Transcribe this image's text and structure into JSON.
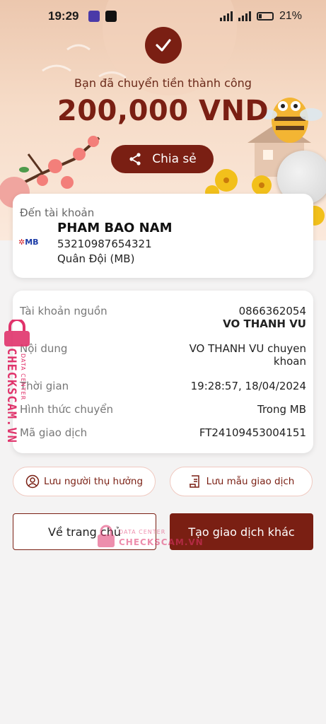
{
  "status_bar": {
    "time": "19:29",
    "battery": "21%"
  },
  "hero": {
    "success_text": "Bạn đã chuyển tiền thành công",
    "amount": "200,000 VND",
    "share_label": "Chia sẻ"
  },
  "destination": {
    "label": "Đến tài khoản",
    "bank_logo": "MB",
    "name": "PHAM BAO NAM",
    "account_number": "53210987654321",
    "bank": "Quân Đội (MB)"
  },
  "details": {
    "rows": [
      {
        "label": "Tài khoản nguồn",
        "value": "0866362054",
        "value2": "VO THANH VU"
      },
      {
        "label": "Nội dung",
        "value": "VO THANH VU chuyen",
        "value2": "khoan"
      },
      {
        "label": "Thời gian",
        "value": "19:28:57, 18/04/2024"
      },
      {
        "label": "Hình thức chuyển",
        "value": "Trong MB"
      },
      {
        "label": "Mã giao dịch",
        "value": "FT24109453004151"
      }
    ]
  },
  "actions": {
    "save_beneficiary": "Lưu người thụ hưởng",
    "save_template": "Lưu mẫu giao dịch",
    "home": "Về trang chủ",
    "new_transaction": "Tạo giao dịch khác"
  },
  "watermark": {
    "brand": "CHECKSCAM.VN",
    "sub": "DATA CENTER"
  },
  "colors": {
    "primary": "#7a1f13",
    "watermark": "#e0336b"
  }
}
